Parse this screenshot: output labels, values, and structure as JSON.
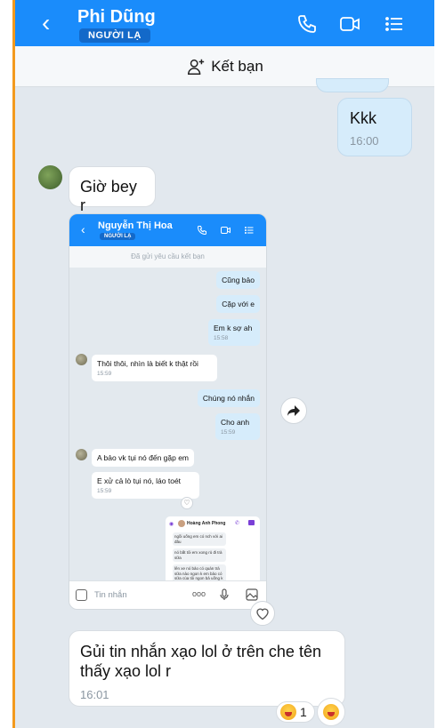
{
  "header": {
    "back_glyph": "‹",
    "contact_name": "Phi Dũng",
    "stranger_badge": "NGƯỜI LẠ",
    "icons": [
      "phone-icon",
      "video-call-icon",
      "menu-list-icon"
    ],
    "accent_color": "#1a8cfb"
  },
  "add_friend_bar": {
    "label": "Kết bạn",
    "icon": "add-friend-icon"
  },
  "messages": [
    {
      "direction": "out",
      "text": "Kkk",
      "time": "16:00"
    },
    {
      "direction": "in",
      "text": "Giờ bey r"
    },
    {
      "direction": "in",
      "type": "image",
      "description_label": ""
    },
    {
      "direction": "in",
      "text": "Gủi tin nhắn xạo lol ở trên che tên thấy xạo lol r",
      "time": "16:01"
    }
  ],
  "reaction": {
    "count": "1",
    "emoji": "laughing-emoji"
  },
  "shot": {
    "contact_name": "Nguyễn Thị Hoa",
    "stranger_badge": "NGƯỜI LẠ",
    "request_sent": "Đã gửi yêu cầu kết bạn",
    "bubbles": [
      {
        "dir": "out",
        "text": "Cũng bảo"
      },
      {
        "dir": "out",
        "text": "Cặp với e"
      },
      {
        "dir": "out",
        "text": "Em k sợ ah",
        "time": "15:58"
      },
      {
        "dir": "in",
        "text": "Thôi thôi, nhìn là biết k thật rồi",
        "time": "15:59"
      },
      {
        "dir": "out",
        "text": "Chúng nó nhắn"
      },
      {
        "dir": "out",
        "text": "Cho anh",
        "time": "15:59"
      },
      {
        "dir": "in",
        "text": "A bảo vk tụi nó đến gặp em"
      },
      {
        "dir": "in",
        "text": "E xử cả lò tụi nó, láo toét",
        "time": "15:59"
      }
    ],
    "nested": {
      "name": "Hoàng Anh Phong",
      "lines": [
        "ngồi uống em có nch với ai đâu",
        "nó bắt tôi em xong rủ đi trà sữa",
        "lên xe nó bảo có quán trà sữa nào ngon k em bảo có sữa của tôi ngon bả uống k nó bảo có"
      ]
    },
    "input_placeholder": "Tin nhắn",
    "more_glyph": "ooo"
  }
}
